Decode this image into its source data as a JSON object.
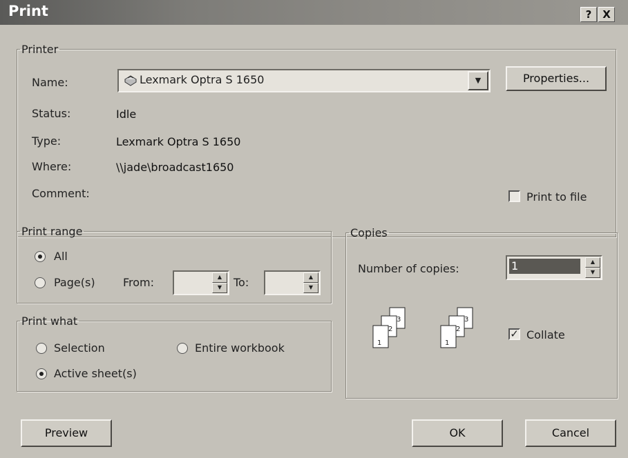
{
  "window": {
    "title": "Print",
    "help_label": "?",
    "close_label": "X"
  },
  "printer": {
    "legend": "Printer",
    "name_label": "Name:",
    "name_value": "Lexmark Optra S 1650",
    "properties_label": "Properties...",
    "status_label": "Status:",
    "status_value": "Idle",
    "type_label": "Type:",
    "type_value": "Lexmark Optra S 1650",
    "where_label": "Where:",
    "where_value": "\\\\jade\\broadcast1650",
    "comment_label": "Comment:",
    "comment_value": "",
    "print_to_file_label": "Print to file",
    "print_to_file_checked": false
  },
  "print_range": {
    "legend": "Print range",
    "all_label": "All",
    "pages_label": "Page(s)",
    "from_label": "From:",
    "to_label": "To:",
    "from_value": "",
    "to_value": "",
    "selected": "All"
  },
  "print_what": {
    "legend": "Print what",
    "selection_label": "Selection",
    "entire_workbook_label": "Entire workbook",
    "active_sheets_label": "Active sheet(s)",
    "selected": "Active sheet(s)"
  },
  "copies": {
    "legend": "Copies",
    "number_label": "Number of copies:",
    "number_value": "1",
    "collate_label": "Collate",
    "collate_checked": true,
    "collate_icon_pages": [
      "1",
      "2",
      "3"
    ]
  },
  "buttons": {
    "preview": "Preview",
    "ok": "OK",
    "cancel": "Cancel"
  }
}
